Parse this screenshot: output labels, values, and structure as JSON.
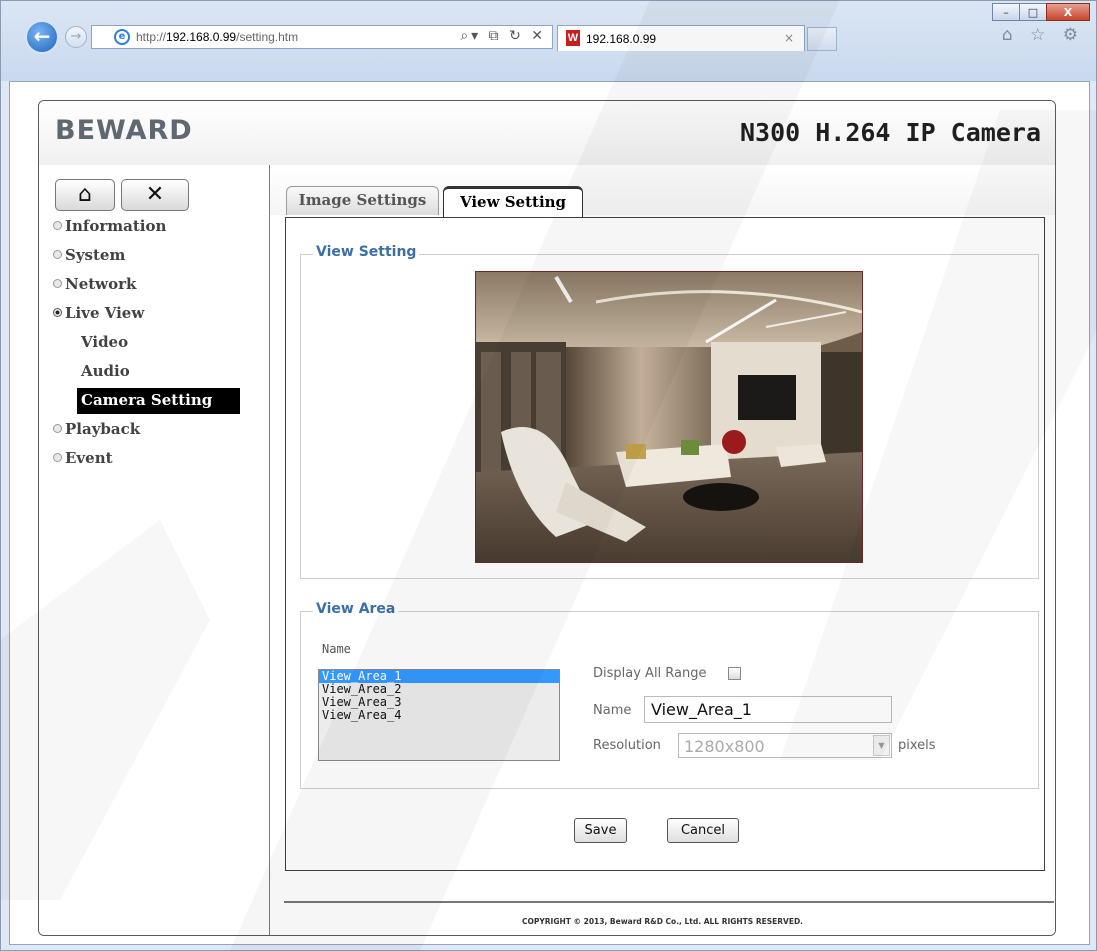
{
  "browser": {
    "url_prefix": "http://",
    "url_host": "192.168.0.99",
    "url_path": "/setting.htm",
    "tab_title": "192.168.0.99",
    "window_controls": [
      "–",
      "□",
      "X"
    ],
    "address_tools": "⌕▾ ⧉ ↻ ✕",
    "chrome_icons": "⌂ ☆ ⚙"
  },
  "header": {
    "logo": "BEWARD",
    "product": "N300 H.264 IP Camera"
  },
  "sidebar": {
    "items": [
      {
        "label": "Information",
        "selected": false
      },
      {
        "label": "System",
        "selected": false
      },
      {
        "label": "Network",
        "selected": false
      },
      {
        "label": "Live View",
        "selected": true
      },
      {
        "label": "Video",
        "sub": true
      },
      {
        "label": "Audio",
        "sub": true
      },
      {
        "label": "Camera Setting",
        "sub": true,
        "active": true
      },
      {
        "label": "Playback",
        "selected": false
      },
      {
        "label": "Event",
        "selected": false
      }
    ]
  },
  "tabs": [
    {
      "label": "Image Settings",
      "active": false
    },
    {
      "label": "View Setting",
      "active": true
    }
  ],
  "view_setting": {
    "legend": "View Setting"
  },
  "view_area": {
    "legend": "View Area",
    "list_caption": "Name",
    "options": [
      "View_Area_1",
      "View_Area_2",
      "View_Area_3",
      "View_Area_4"
    ],
    "selected_index": 0,
    "display_all_range_label": "Display All Range",
    "display_all_range_checked": false,
    "name_label": "Name",
    "name_value": "View_Area_1",
    "resolution_label": "Resolution",
    "resolution_value": "1280x800",
    "resolution_unit": "pixels"
  },
  "buttons": {
    "save": "Save",
    "cancel": "Cancel"
  },
  "footer": {
    "copyright": "COPYRIGHT © 2013, Beward R&D Co., Ltd. ALL RIGHTS RESERVED."
  }
}
